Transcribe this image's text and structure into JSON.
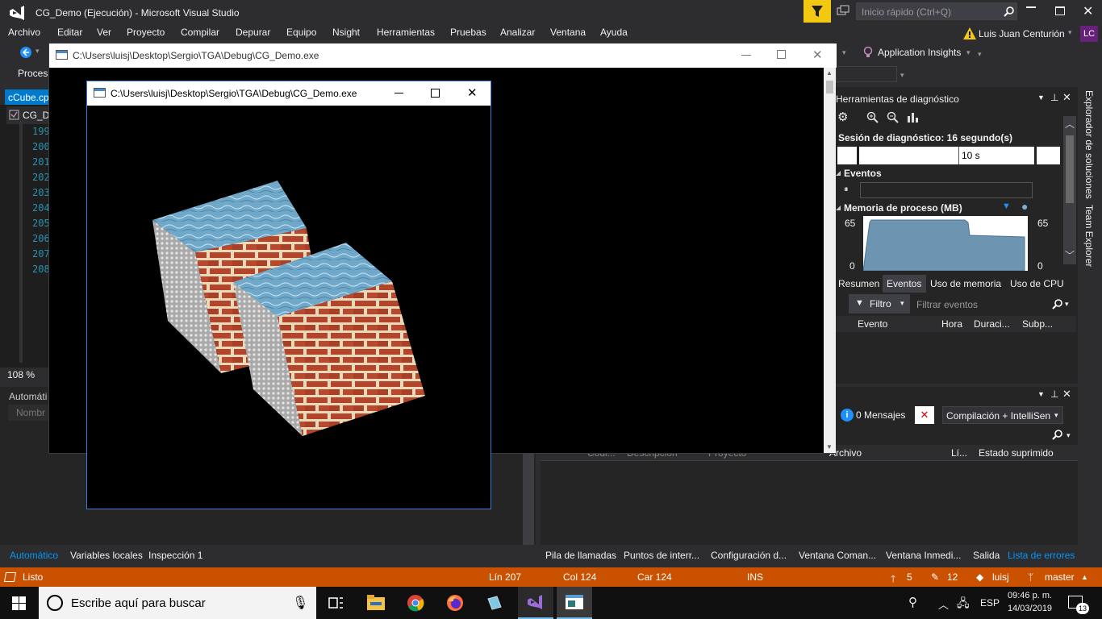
{
  "vs": {
    "window_title": "CG_Demo (Ejecución) - Microsoft Visual Studio",
    "quick_launch_placeholder": "Inicio rápido (Ctrl+Q)",
    "user_name": "Luis Juan Centurión",
    "user_initials": "LC",
    "menu": [
      "Archivo",
      "Editar",
      "Ver",
      "Proyecto",
      "Compilar",
      "Depurar",
      "Equipo",
      "Nsight",
      "Herramientas",
      "Pruebas",
      "Analizar",
      "Ventana",
      "Ayuda"
    ],
    "toolbar": {
      "app_insights": "Application Insights",
      "process_label": "Proces"
    },
    "editor": {
      "tab_file": "cCube.cp",
      "tab_project": "CG_De",
      "line_numbers": [
        "199",
        "200",
        "201",
        "202",
        "203",
        "204",
        "205",
        "206",
        "207",
        "208"
      ],
      "zoom": "108 %"
    },
    "autos": {
      "title": "Automáti",
      "col_name": "Nombr"
    },
    "diagnostics": {
      "title": "Herramientas de diagnóstico",
      "session": "Sesión de diagnóstico: 16 segundo(s)",
      "tick_10s": "10 s",
      "events_label": "Eventos",
      "memory_label": "Memoria de proceso (MB)",
      "mem_max_left": "65",
      "mem_min_left": "0",
      "mem_max_right": "65",
      "mem_min_right": "0",
      "tabs": [
        "Resumen",
        "Eventos",
        "Uso de memoria",
        "Uso de CPU"
      ],
      "filter_label": "Filtro",
      "filter_placeholder": "Filtrar eventos",
      "columns": [
        "Evento",
        "Hora",
        "Duraci...",
        "Subp..."
      ]
    },
    "errlist": {
      "messages": "0 Mensajes",
      "build_filter": "Compilación + IntelliSen",
      "columns": [
        "Códi...",
        "Descripción",
        "Proyecto",
        "Archivo",
        "Lí...",
        "Estado suprimido"
      ]
    },
    "side_rail": [
      "Explorador de soluciones",
      "Team Explorer"
    ],
    "bottom_tabs_left": [
      "Automático",
      "Variables locales",
      "Inspección 1"
    ],
    "bottom_tabs_right": [
      "Pila de llamadas",
      "Puntos de interr...",
      "Configuración d...",
      "Ventana Coman...",
      "Ventana Inmedi...",
      "Salida",
      "Lista de errores"
    ],
    "status": {
      "ready": "Listo",
      "line": "Lín 207",
      "col": "Col 124",
      "char": "Car 124",
      "mode": "INS",
      "up_count": "5",
      "edit_count": "12",
      "repo": "luisj",
      "branch": "master"
    }
  },
  "console_window": {
    "title": "C:\\Users\\luisj\\Desktop\\Sergio\\TGA\\Debug\\CG_Demo.exe"
  },
  "glut_window": {
    "title": "C:\\Users\\luisj\\Desktop\\Sergio\\TGA\\Debug\\CG_Demo.exe"
  },
  "taskbar": {
    "search_placeholder": "Escribe aquí para buscar",
    "lang": "ESP",
    "time": "09:46 p. m.",
    "date": "14/03/2019",
    "notifications": "13"
  },
  "colors": {
    "vs_bg": "#2d2d30",
    "status_bar": "#ca5100",
    "accent": "#007acc"
  }
}
